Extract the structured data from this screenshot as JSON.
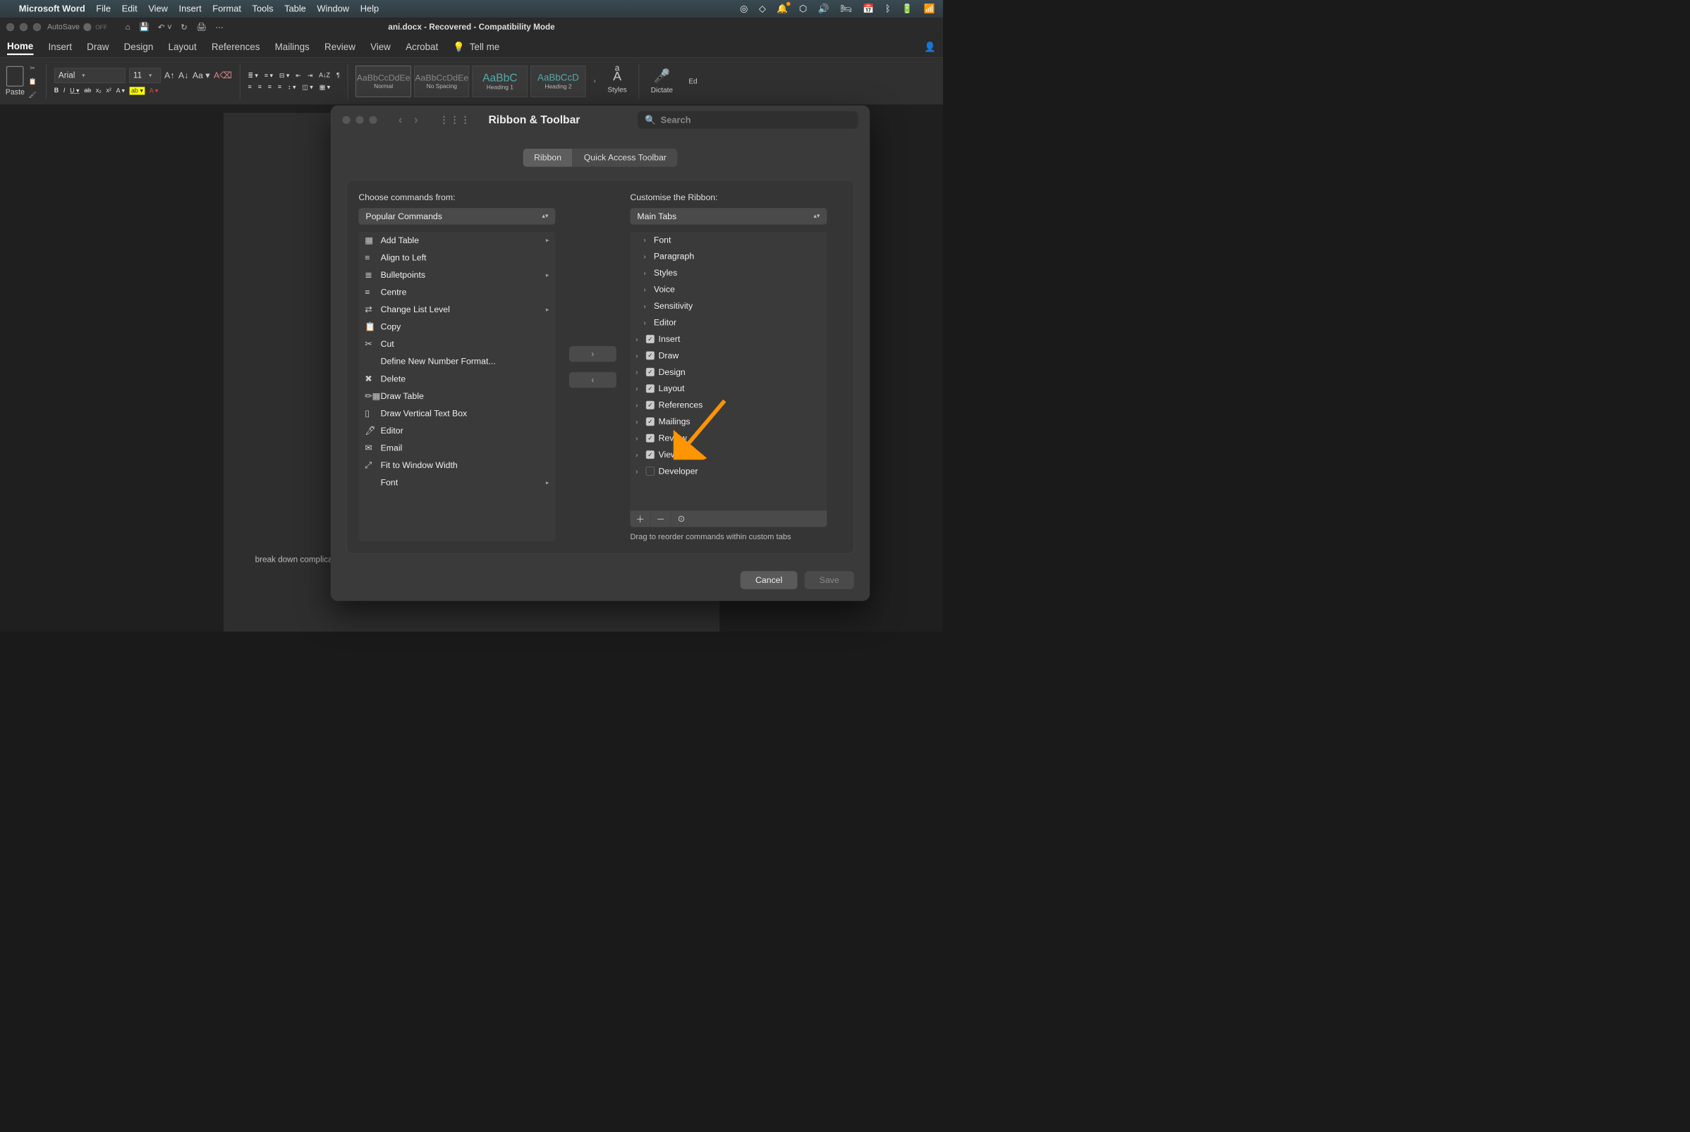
{
  "mac_menu": {
    "app_name": "Microsoft Word",
    "items": [
      "File",
      "Edit",
      "View",
      "Insert",
      "Format",
      "Tools",
      "Table",
      "Window",
      "Help"
    ]
  },
  "word_titlebar": {
    "autosave_label": "AutoSave",
    "autosave_state": "OFF",
    "doc_title": "ani.docx  -  Recovered  -  Compatibility Mode"
  },
  "ribbon_tabs": [
    "Home",
    "Insert",
    "Draw",
    "Design",
    "Layout",
    "References",
    "Mailings",
    "Review",
    "View",
    "Acrobat"
  ],
  "ribbon_tellme": "Tell me",
  "ribbon": {
    "paste_label": "Paste",
    "font_name": "Arial",
    "font_size": "11",
    "styles": [
      {
        "preview": "AaBbCcDdEe",
        "name": "Normal"
      },
      {
        "preview": "AaBbCcDdEe",
        "name": "No Spacing"
      },
      {
        "preview": "AaBbC",
        "name": "Heading 1"
      },
      {
        "preview": "AaBbCcD",
        "name": "Heading 2"
      }
    ],
    "styles_label": "Styles",
    "dictate_label": "Dictate",
    "editor_label": "Ed"
  },
  "dialog": {
    "title": "Ribbon & Toolbar",
    "search_placeholder": "Search",
    "seg_tabs": [
      "Ribbon",
      "Quick Access Toolbar"
    ],
    "left_label": "Choose commands from:",
    "left_dropdown": "Popular Commands",
    "right_label": "Customise the Ribbon:",
    "right_dropdown": "Main Tabs",
    "commands": [
      {
        "label": "Add Table",
        "icon": "table",
        "sub": true
      },
      {
        "label": "Align to Left",
        "icon": "align-left"
      },
      {
        "label": "Bulletpoints",
        "icon": "bullets",
        "sub": true
      },
      {
        "label": "Centre",
        "icon": "align-center"
      },
      {
        "label": "Change List Level",
        "icon": "list-level",
        "sub": true
      },
      {
        "label": "Copy",
        "icon": "copy"
      },
      {
        "label": "Cut",
        "icon": "cut"
      },
      {
        "label": "Define New Number Format...",
        "icon": ""
      },
      {
        "label": "Delete",
        "icon": "delete"
      },
      {
        "label": "Draw Table",
        "icon": "draw-table"
      },
      {
        "label": "Draw Vertical Text Box",
        "icon": "vtextbox"
      },
      {
        "label": "Editor",
        "icon": "editor"
      },
      {
        "label": "Email",
        "icon": "email"
      },
      {
        "label": "Fit to Window Width",
        "icon": "fit"
      },
      {
        "label": "Font",
        "icon": "",
        "sub": true
      }
    ],
    "tabs_tree": [
      {
        "label": "Font",
        "checked": null,
        "level": 1
      },
      {
        "label": "Paragraph",
        "checked": null,
        "level": 1
      },
      {
        "label": "Styles",
        "checked": null,
        "level": 1
      },
      {
        "label": "Voice",
        "checked": null,
        "level": 1
      },
      {
        "label": "Sensitivity",
        "checked": null,
        "level": 1
      },
      {
        "label": "Editor",
        "checked": null,
        "level": 1
      },
      {
        "label": "Insert",
        "checked": true,
        "level": 0
      },
      {
        "label": "Draw",
        "checked": true,
        "level": 0
      },
      {
        "label": "Design",
        "checked": true,
        "level": 0
      },
      {
        "label": "Layout",
        "checked": true,
        "level": 0
      },
      {
        "label": "References",
        "checked": true,
        "level": 0
      },
      {
        "label": "Mailings",
        "checked": true,
        "level": 0
      },
      {
        "label": "Review",
        "checked": true,
        "level": 0
      },
      {
        "label": "View",
        "checked": true,
        "level": 0
      },
      {
        "label": "Developer",
        "checked": false,
        "level": 0
      }
    ],
    "reorder_hint": "Drag to reorder commands within custom tabs",
    "cancel": "Cancel",
    "save": "Save"
  },
  "doc_text": "break down complicated processes or products into digestible pieces for their target audience."
}
